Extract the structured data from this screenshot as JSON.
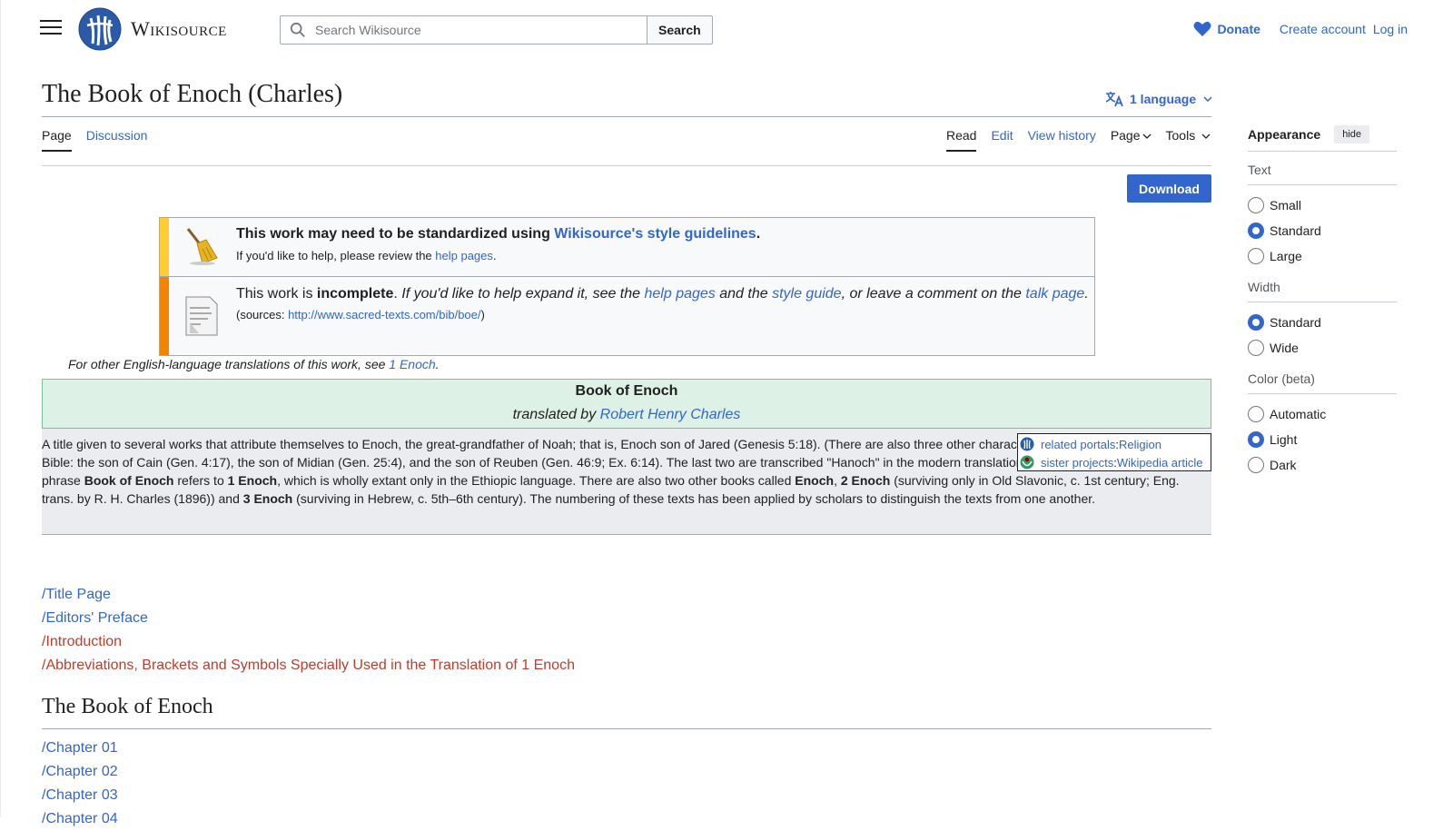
{
  "header": {
    "site_name": "Wikisource",
    "search_placeholder": "Search Wikisource",
    "search_button": "Search",
    "donate": "Donate",
    "create_account": "Create account",
    "log_in": "Log in"
  },
  "page": {
    "title": "The Book of Enoch (Charles)",
    "language_button": "1 language",
    "tabs_left": [
      "Page",
      "Discussion"
    ],
    "tabs_right": [
      "Read",
      "Edit",
      "View history",
      "Page",
      "Tools"
    ],
    "download": "Download"
  },
  "notice1": {
    "main_prefix": "This work may need to be standardized using ",
    "main_link": "Wikisource's style guidelines",
    "main_suffix": ".",
    "sub_prefix": "If you'd like to help, please review the ",
    "sub_link": "help pages",
    "sub_suffix": "."
  },
  "notice2": {
    "p1": "This work is ",
    "bold": "incomplete",
    "p2": ". ",
    "i1": "If you'd like to help expand it, see the ",
    "link1": "help pages",
    "i2": " and the ",
    "link2": "style guide",
    "i3": ", or leave a comment on the ",
    "link3": "talk page",
    "end": ".",
    "sources_prefix": "(sources: ",
    "sources_link": "http://www.sacred-texts.com/bib/boe/",
    "sources_suffix": ")"
  },
  "other_translations": {
    "prefix": "For other English-language translations of this work, see ",
    "link": "1 Enoch",
    "suffix": "."
  },
  "work_header": {
    "title": "Book of Enoch",
    "translated_by": "translated by ",
    "translator": "Robert Henry Charles"
  },
  "description": {
    "s1": "A title given to several works that attribute themselves to Enoch, the great-grandfather of Noah; that is, Enoch son of Jared (Genesis 5:18). (There are also three other characters named Enoch in the Bible: the son of Cain (Gen. 4:17), the son of Midian (Gen. 25:4), and the son of Reuben (Gen. 46:9; Ex. 6:14). The last two are transcribed \"Hanoch\" in the modern translations.) Most commonly, the phrase ",
    "b1": "Book of Enoch",
    "s2": " refers to ",
    "b2": "1 Enoch",
    "s3": ", which is wholly extant only in the Ethiopic language. There are also two other books called ",
    "b3": "Enoch",
    "s4": ", ",
    "b4": "2 Enoch",
    "s5": " (surviving only in Old Slavonic, c. 1st century; Eng. trans. by R. H. Charles (1896)) and ",
    "b5": "3 Enoch",
    "s6": " (surviving in Hebrew, c. 5th–6th century). The numbering of these texts has been applied by scholars to distinguish the texts from one another."
  },
  "related": {
    "portals_label": "related portals",
    "portals_value": "Religion",
    "sister_label": "sister projects",
    "sister_value": "Wikipedia article",
    "sep": ": "
  },
  "toc": [
    {
      "label": "/Title Page",
      "exists": true
    },
    {
      "label": "/Editors' Preface",
      "exists": true
    },
    {
      "label": "/Introduction",
      "exists": false
    },
    {
      "label": "/Abbreviations, Brackets and Symbols Specially Used in the Translation of 1 Enoch",
      "exists": false
    }
  ],
  "section": {
    "title": "The Book of Enoch",
    "chapters": [
      "/Chapter 01",
      "/Chapter 02",
      "/Chapter 03",
      "/Chapter 04"
    ]
  },
  "appearance": {
    "title": "Appearance",
    "hide": "hide",
    "groups": [
      {
        "label": "Text",
        "options": [
          "Small",
          "Standard",
          "Large"
        ],
        "selected": "Standard"
      },
      {
        "label": "Width",
        "options": [
          "Standard",
          "Wide"
        ],
        "selected": "Standard"
      },
      {
        "label": "Color (beta)",
        "options": [
          "Automatic",
          "Light",
          "Dark"
        ],
        "selected": "Light"
      }
    ]
  },
  "colors": {
    "link": "#3366cc",
    "redlink": "#bf3c2c",
    "button": "#3366cc",
    "header_box": "#ddf1e6",
    "notice_style": "#ffcc33",
    "notice_incomplete": "#f28500"
  }
}
